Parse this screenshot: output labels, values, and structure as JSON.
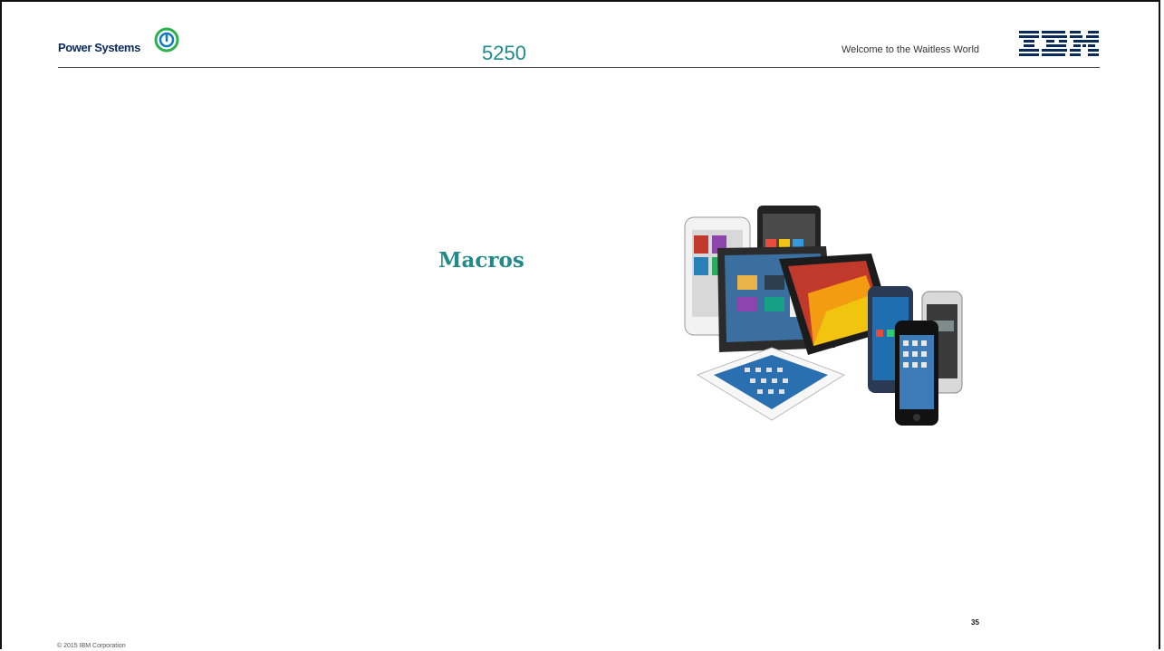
{
  "header": {
    "brand": "Power Systems",
    "title": "5250",
    "tagline": "Welcome to the Waitless World",
    "ibm_logo": "IBM"
  },
  "content": {
    "section_title": "Macros",
    "image": "devices-collage"
  },
  "footer": {
    "page_number": "35",
    "copyright": "© 2015 IBM Corporation"
  },
  "colors": {
    "accent": "#23898a",
    "brand_blue": "#0a2a5c",
    "logo_green": "#2bb24c",
    "logo_blue": "#0f7ac0"
  }
}
